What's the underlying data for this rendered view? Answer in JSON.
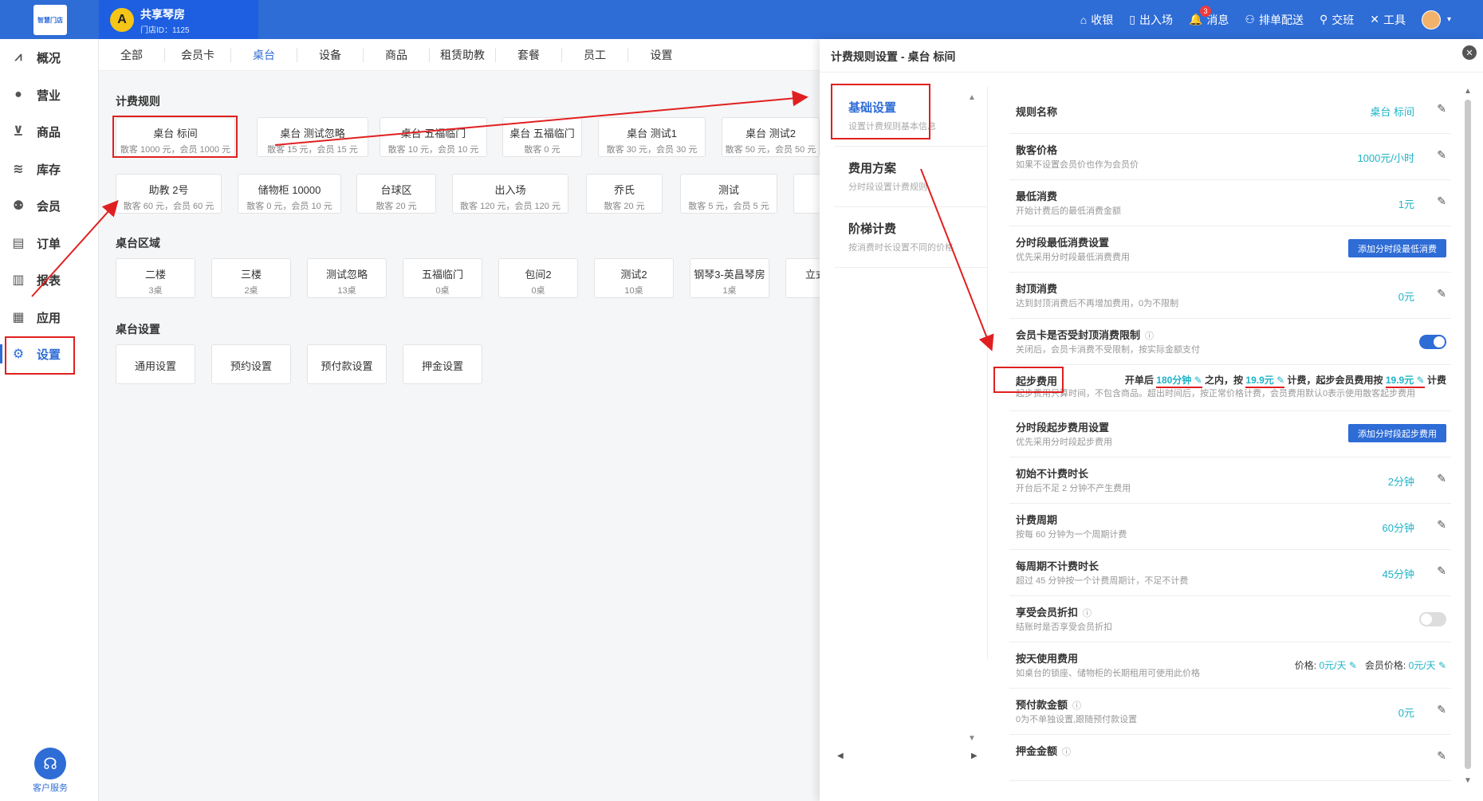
{
  "header": {
    "logo_text": "智慧门店",
    "store_initial": "A",
    "store_name": "共享琴房",
    "store_id": "门店ID：1125",
    "tools": [
      {
        "icon": "cashier-icon",
        "glyph": "⌂",
        "label": "收银"
      },
      {
        "icon": "door-icon",
        "glyph": "▯",
        "label": "出入场"
      },
      {
        "icon": "bell-icon",
        "glyph": "🔔",
        "label": "消息",
        "badge": "3"
      },
      {
        "icon": "schedule-icon",
        "glyph": "⚇",
        "label": "排单配送"
      },
      {
        "icon": "handover-icon",
        "glyph": "⚲",
        "label": "交班"
      },
      {
        "icon": "tools-icon",
        "glyph": "✕",
        "label": "工具"
      }
    ]
  },
  "sidebar": {
    "items": [
      {
        "icon": "chart-icon",
        "glyph": "📈",
        "label": "概况"
      },
      {
        "icon": "business-icon",
        "glyph": "💰",
        "label": "营业"
      },
      {
        "icon": "cart-icon",
        "glyph": "🛒",
        "label": "商品"
      },
      {
        "icon": "stack-icon",
        "glyph": "≋",
        "label": "库存"
      },
      {
        "icon": "member-icon",
        "glyph": "👥",
        "label": "会员"
      },
      {
        "icon": "order-icon",
        "glyph": "▤",
        "label": "订单"
      },
      {
        "icon": "report-icon",
        "glyph": "▥",
        "label": "报表"
      },
      {
        "icon": "apps-icon",
        "glyph": "▦",
        "label": "应用"
      },
      {
        "icon": "gear-icon",
        "glyph": "⚙",
        "label": "设置"
      }
    ],
    "service_label": "客户服务"
  },
  "main": {
    "tabs": [
      "全部",
      "会员卡",
      "桌台",
      "设备",
      "商品",
      "租赁助教",
      "套餐",
      "员工",
      "设置"
    ],
    "active_tab": 2,
    "billing_title": "计费规则",
    "billing_row1": [
      {
        "t": "桌台 标间",
        "s": "散客 1000 元，会员 1000 元"
      },
      {
        "t": "桌台 测试忽略",
        "s": "散客 15 元，会员 15 元"
      },
      {
        "t": "桌台 五福临门",
        "s": "散客 10 元，会员 10 元"
      },
      {
        "t": "桌台 五福临门",
        "s": "散客 0 元"
      },
      {
        "t": "桌台 测试1",
        "s": "散客 30 元，会员 30 元"
      },
      {
        "t": "桌台 测试2",
        "s": "散客 50 元，会员 50 元"
      }
    ],
    "billing_row2": [
      {
        "t": "助教 2号",
        "s": "散客 60 元，会员 60 元"
      },
      {
        "t": "储物柜 10000",
        "s": "散客 0 元，会员 10 元"
      },
      {
        "t": "台球区",
        "s": "散客 20 元"
      },
      {
        "t": "出入场",
        "s": "散客 120 元，会员 120 元"
      },
      {
        "t": "乔氏",
        "s": "散客 20 元"
      },
      {
        "t": "测试",
        "s": "散客 5 元，会员 5 元"
      }
    ],
    "area_title": "桌台区域",
    "areas": [
      {
        "t": "二楼",
        "s": "3桌"
      },
      {
        "t": "三楼",
        "s": "2桌"
      },
      {
        "t": "测试忽略",
        "s": "13桌"
      },
      {
        "t": "五福临门",
        "s": "0桌"
      },
      {
        "t": "包间2",
        "s": "0桌"
      },
      {
        "t": "测试2",
        "s": "10桌"
      },
      {
        "t": "钢琴3-英昌琴房",
        "s": "1桌"
      },
      {
        "t": "立式",
        "s": ""
      }
    ],
    "settings_title": "桌台设置",
    "settings": [
      "通用设置",
      "预约设置",
      "预付款设置",
      "押金设置"
    ]
  },
  "drawer": {
    "title": "计费规则设置 - 桌台 标间",
    "nav": [
      {
        "t": "基础设置",
        "s": "设置计费规则基本信息"
      },
      {
        "t": "费用方案",
        "s": "分时段设置计费规则"
      },
      {
        "t": "阶梯计费",
        "s": "按消费时长设置不同的价格"
      }
    ],
    "rows": [
      {
        "t": "规则名称",
        "s": "",
        "v": "桌台 标间",
        "ctl": "edit"
      },
      {
        "t": "散客价格",
        "s": "如果不设置会员价也作为会员价",
        "v": "1000元/小时",
        "ctl": "edit"
      },
      {
        "t": "最低消费",
        "s": "开始计费后的最低消费金额",
        "v": "1元",
        "ctl": "edit"
      },
      {
        "t": "分时段最低消费设置",
        "s": "优先采用分时段最低消费费用",
        "v": "",
        "ctl": "btn",
        "btn": "添加分时段最低消费"
      },
      {
        "t": "封顶消费",
        "s": "达到封顶消费后不再增加费用，0为不限制",
        "v": "0元",
        "ctl": "edit"
      },
      {
        "t": "会员卡是否受封顶消费限制",
        "s": "关闭后，会员卡消费不受限制，按实际金额支付",
        "v": "",
        "ctl": "toggle-on",
        "info": "ⓘ"
      },
      {
        "t": "起步费用",
        "s": "起步费用只算时间，不包含商品。超出时间后，按正常价格计费，会员费用默认0表示使用散客起步费用",
        "v": "",
        "ctl": "start"
      },
      {
        "t": "分时段起步费用设置",
        "s": "优先采用分时段起步费用",
        "v": "",
        "ctl": "btn",
        "btn": "添加分时段起步费用"
      },
      {
        "t": "初始不计费时长",
        "s": "开台后不足 2 分钟不产生费用",
        "v": "2分钟",
        "ctl": "edit"
      },
      {
        "t": "计费周期",
        "s": "按每 60 分钟为一个周期计费",
        "v": "60分钟",
        "ctl": "edit"
      },
      {
        "t": "每周期不计费时长",
        "s": "超过 45 分钟按一个计费周期计，不足不计费",
        "v": "45分钟",
        "ctl": "edit"
      },
      {
        "t": "享受会员折扣",
        "s": "结账时是否享受会员折扣",
        "v": "",
        "ctl": "toggle-off",
        "info": "ⓘ"
      },
      {
        "t": "按天使用费用",
        "s": "如桌台的锁座、储物柜的长期租用可使用此价格",
        "v": "",
        "ctl": "day"
      },
      {
        "t": "预付款金额",
        "s": "0为不单独设置,跟随预付款设置",
        "v": "0元",
        "ctl": "edit",
        "info": "ⓘ"
      },
      {
        "t": "押金金额",
        "s": "",
        "v": "",
        "ctl": "edit",
        "info": "ⓘ"
      }
    ],
    "start_fee": {
      "p1": "开单后",
      "minutes": "180分钟",
      "p2": "之内，按",
      "price": "19.9元",
      "p3": "计费，起步会员费用按",
      "member_price": "19.9元",
      "p4": "计费"
    },
    "day_fee": {
      "price_label": "价格:",
      "price": "0元/天",
      "member_label": "会员价格:",
      "member_price": "0元/天"
    }
  },
  "colors": {
    "primary": "#2e6cd6",
    "accent_value": "#1fb3c7",
    "annotation_red": "#e02020"
  }
}
